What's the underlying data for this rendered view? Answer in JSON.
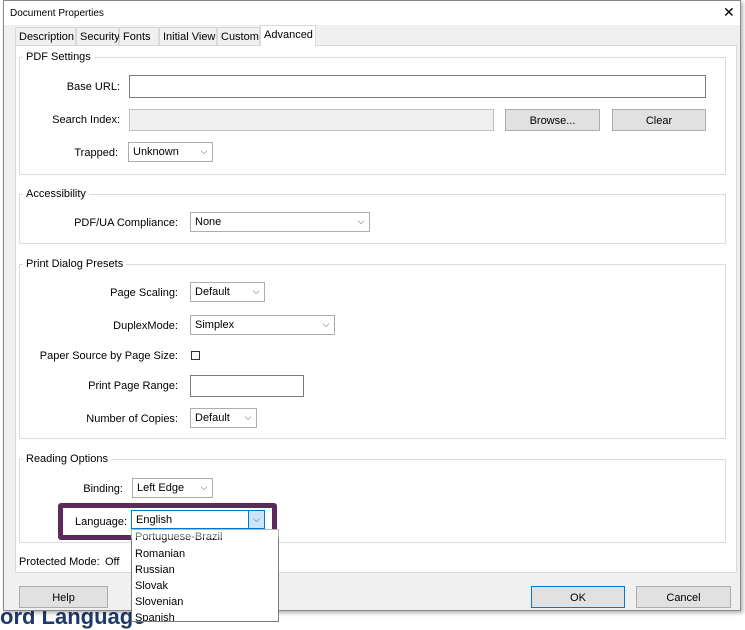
{
  "background": {
    "partial_text": "ord Language"
  },
  "window": {
    "title": "Document Properties",
    "close_icon": "close-icon"
  },
  "tabs": [
    {
      "label": "Description"
    },
    {
      "label": "Security"
    },
    {
      "label": "Fonts"
    },
    {
      "label": "Initial View"
    },
    {
      "label": "Custom"
    },
    {
      "label": "Advanced",
      "selected": true
    }
  ],
  "pdf_settings": {
    "title": "PDF Settings",
    "base_url_label": "Base URL:",
    "base_url_value": "",
    "search_index_label": "Search Index:",
    "search_index_value": "",
    "browse_label": "Browse...",
    "clear_label": "Clear",
    "trapped_label": "Trapped:",
    "trapped_value": "Unknown"
  },
  "accessibility": {
    "title": "Accessibility",
    "pdfua_label": "PDF/UA Compliance:",
    "pdfua_value": "None"
  },
  "print_presets": {
    "title": "Print Dialog Presets",
    "page_scaling_label": "Page Scaling:",
    "page_scaling_value": "Default",
    "duplex_label": "DuplexMode:",
    "duplex_value": "Simplex",
    "paper_source_label": "Paper Source by Page Size:",
    "paper_source_checked": false,
    "page_range_label": "Print Page Range:",
    "page_range_value": "",
    "copies_label": "Number of Copies:",
    "copies_value": "Default"
  },
  "reading": {
    "title": "Reading Options",
    "binding_label": "Binding:",
    "binding_value": "Left Edge",
    "language_label": "Language:",
    "language_value": "English",
    "highlight_color": "#5c2a5e",
    "language_options": [
      "Portuguese-Brazil",
      "Romanian",
      "Russian",
      "Slovak",
      "Slovenian",
      "Spanish"
    ]
  },
  "protected_mode": {
    "label": "Protected Mode:",
    "value": "Off"
  },
  "buttons": {
    "help": "Help",
    "ok": "OK",
    "cancel": "Cancel"
  }
}
